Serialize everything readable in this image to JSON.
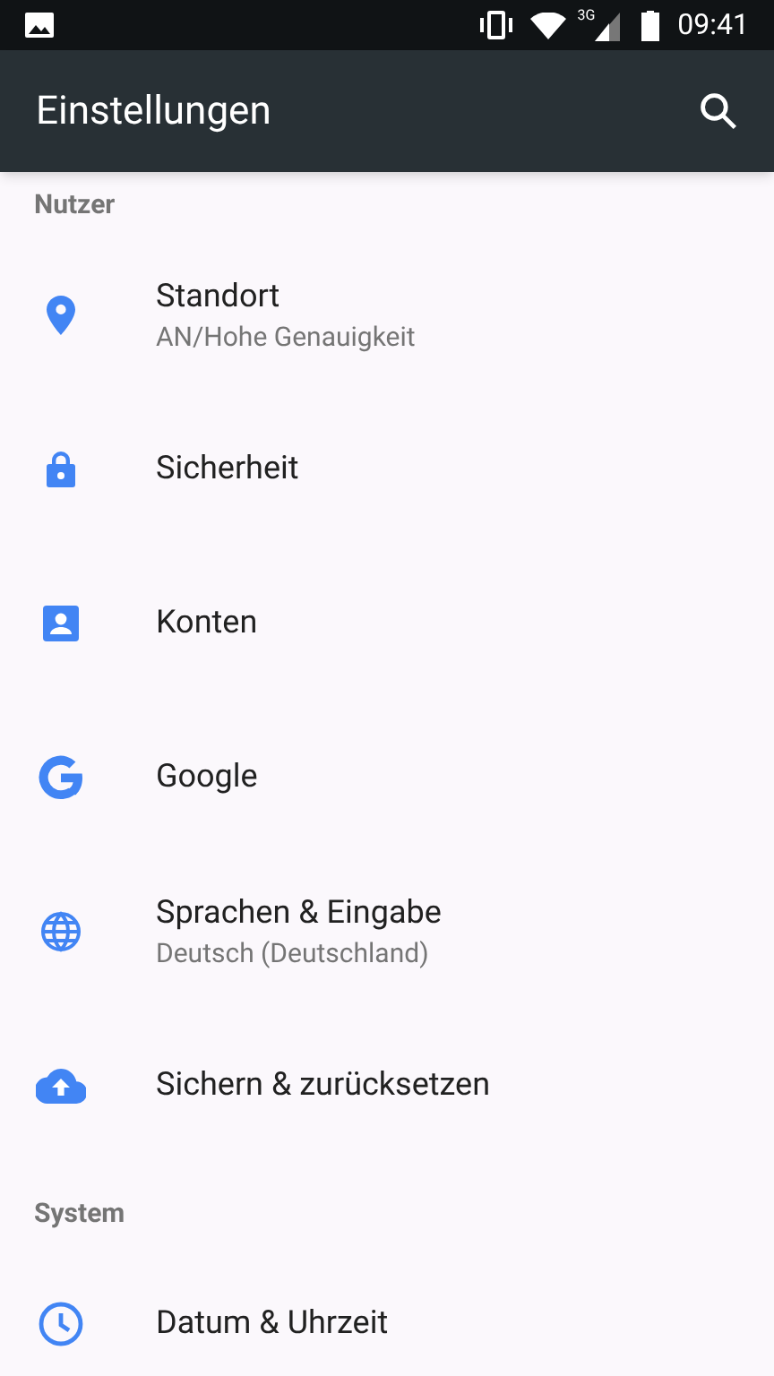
{
  "status_bar": {
    "network": "3G",
    "time": "09:41"
  },
  "app_bar": {
    "title": "Einstellungen"
  },
  "sections": [
    {
      "title": "Nutzer",
      "items": [
        {
          "title": "Standort",
          "subtitle": "AN/Hohe Genauigkeit"
        },
        {
          "title": "Sicherheit"
        },
        {
          "title": "Konten"
        },
        {
          "title": "Google"
        },
        {
          "title": "Sprachen & Eingabe",
          "subtitle": "Deutsch (Deutschland)"
        },
        {
          "title": "Sichern & zurücksetzen"
        }
      ]
    },
    {
      "title": "System",
      "items": [
        {
          "title": "Datum & Uhrzeit"
        }
      ]
    }
  ]
}
